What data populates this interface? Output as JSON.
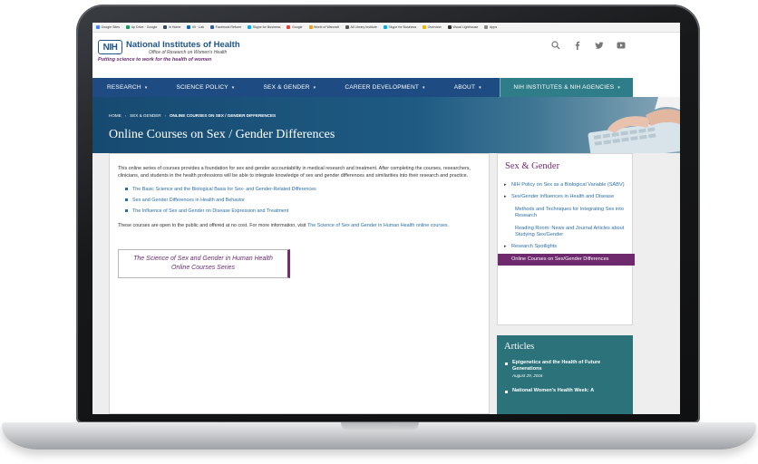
{
  "bookmarks": [
    {
      "label": "Google Sites",
      "color": "#4285f4"
    },
    {
      "label": "Up Drive · Google",
      "color": "#0f9d58"
    },
    {
      "label": "In Home",
      "color": "#34495e"
    },
    {
      "label": "IIII · Lab",
      "color": "#0a66c2"
    },
    {
      "label": "Facebook Reform",
      "color": "#3b5998"
    },
    {
      "label": "Skype for Business",
      "color": "#00aff0"
    },
    {
      "label": "Google",
      "color": "#ea4335"
    },
    {
      "label": "World of Warcraft",
      "color": "#e8a317"
    },
    {
      "label": "All Library Institute",
      "color": "#555555"
    },
    {
      "label": "Skype for Business",
      "color": "#00aff0"
    },
    {
      "label": "Overview",
      "color": "#f4b400"
    },
    {
      "label": "Visual Lighthouse",
      "color": "#333333"
    },
    {
      "label": "Apps",
      "color": "#888888"
    }
  ],
  "header": {
    "logo_text": "NIH",
    "org_name": "National Institutes of Health",
    "org_sub": "Office of Research on Women's Health",
    "tagline": "Putting science to work for the health of women",
    "icons": [
      "search-icon",
      "facebook-icon",
      "twitter-icon",
      "youtube-icon"
    ]
  },
  "nav": {
    "items": [
      {
        "label": "RESEARCH",
        "caret": "▾"
      },
      {
        "label": "SCIENCE POLICY",
        "caret": "▾"
      },
      {
        "label": "SEX & GENDER",
        "caret": "▾"
      },
      {
        "label": "CAREER DEVELOPMENT",
        "caret": "▾"
      },
      {
        "label": "ABOUT",
        "caret": "▾"
      }
    ],
    "institutes": {
      "label": "NIH INSTITUTES & NIH AGENCIES",
      "caret": "▾"
    }
  },
  "hero": {
    "breadcrumb": [
      "HOME",
      "SEX & GENDER",
      "ONLINE COURSES ON SEX / GENDER DIFFERENCES"
    ],
    "title": "Online Courses on Sex / Gender Differences"
  },
  "main": {
    "intro": "This online series of courses provides a foundation for sex and gender accountability in medical research and treatment. After completing the courses, researchers, clinicians, and students in the health professions will be able to integrate knowledge of sex and gender differences and similarities into their research and practice.",
    "courses": [
      "The Basic Science and the Biological Basis for Sex- and Gender-Related Differences",
      "Sex and Gender Differences in Health and Behavior",
      "The Influence of Sex and Gender on Disease Expression and Treatment"
    ],
    "open_note": "These courses are open to the public and offered at no cost. For more information, visit",
    "open_note_link": "The Science of Sex and Gender in Human Health online courses.",
    "series_line1": "The Science of Sex and Gender in Human Health",
    "series_line2": "Online Courses Series"
  },
  "sidebar": {
    "title": "Sex & Gender",
    "items": [
      {
        "label": "NIH Policy on Sex as a Biological Variable (SABV)",
        "arrow": "▸"
      },
      {
        "label": "Sex/Gender Influences in Health and Disease",
        "arrow": "▸"
      },
      {
        "label": "Methods and Techniques for Integrating Sex into Research",
        "arrow": ""
      },
      {
        "label": "Reading Room: News and Journal Articles about Studying Sex/Gender",
        "arrow": ""
      },
      {
        "label": "Research Spotlights",
        "arrow": "▸"
      },
      {
        "label": "Online Courses on Sex/Gender Differences",
        "arrow": ""
      }
    ]
  },
  "articles": {
    "title": "Articles",
    "items": [
      {
        "title": "Epigenetics and the Health of Future Generations",
        "date": "August 29, 2016"
      },
      {
        "title": "National Women's Health Week: A",
        "date": ""
      }
    ]
  }
}
